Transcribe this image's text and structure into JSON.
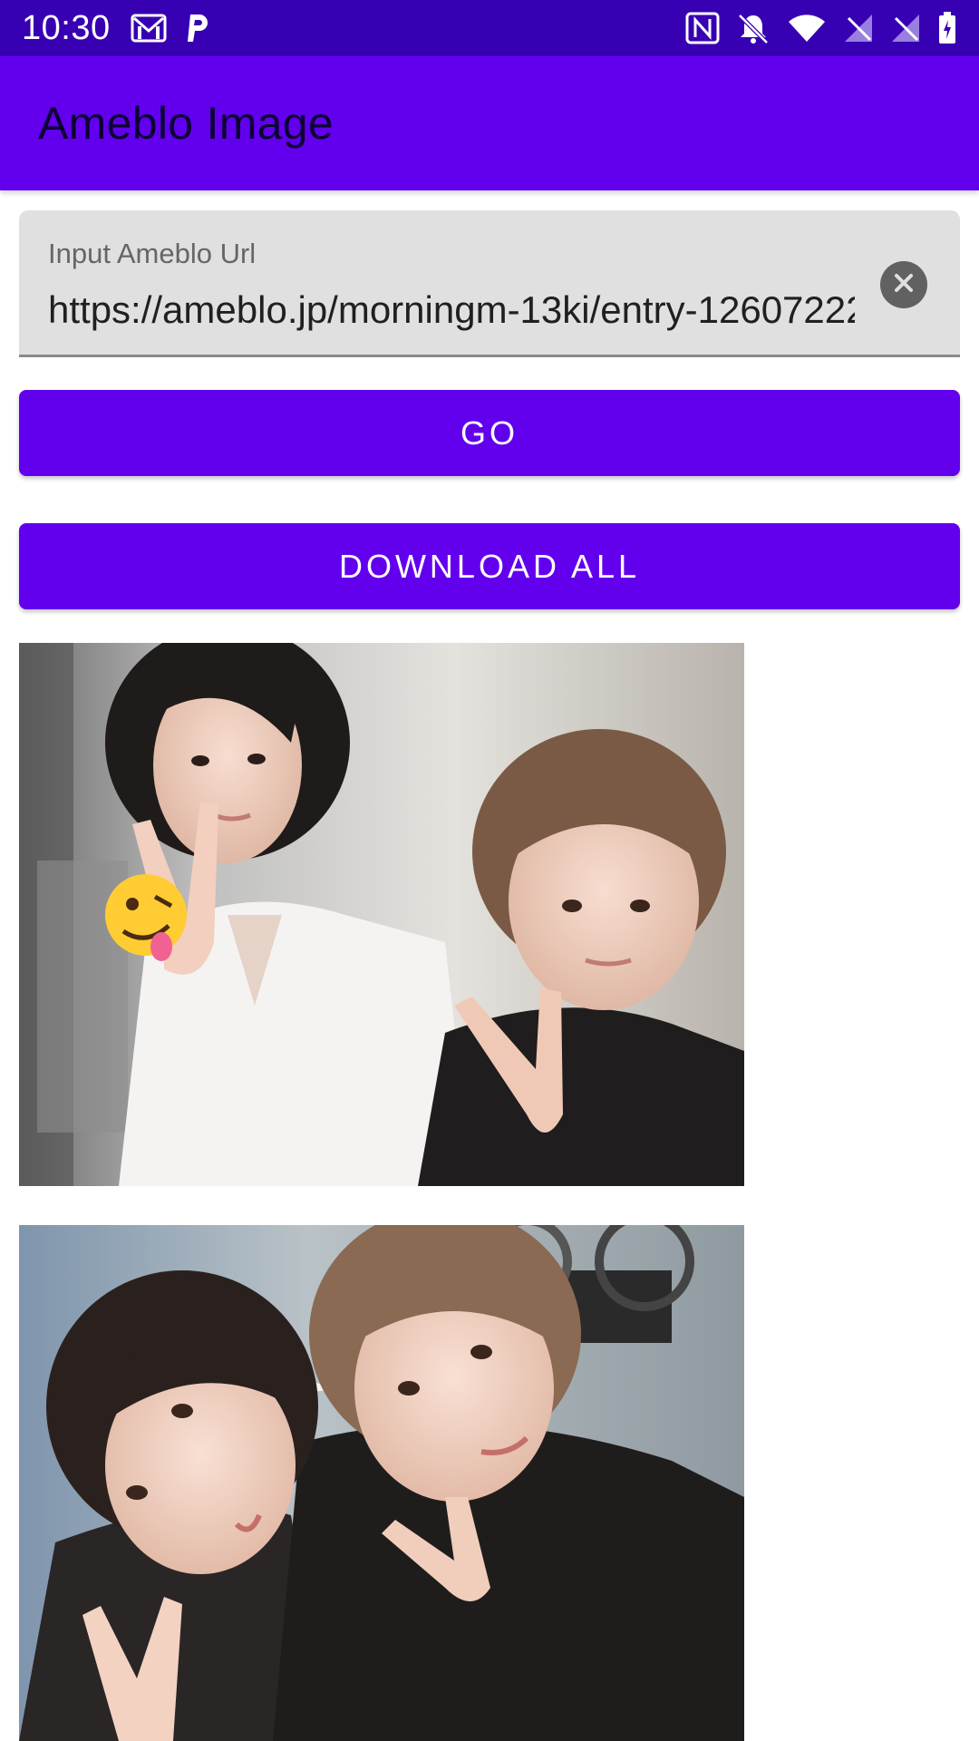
{
  "status_bar": {
    "time": "10:30",
    "left_icons": [
      "gmail-icon",
      "parking-icon"
    ],
    "right_icons": [
      "nfc-icon",
      "bell-off-icon",
      "wifi-icon",
      "signal-icon",
      "signal-icon",
      "battery-icon"
    ]
  },
  "app_bar": {
    "title": "Ameblo Image"
  },
  "url_field": {
    "label": "Input Ameblo Url",
    "value": "https://ameblo.jp/morningm-13ki/entry-12607222"
  },
  "buttons": {
    "go_label": "GO",
    "download_all_label": "DOWNLOAD ALL"
  },
  "images": [
    {
      "kind": "photo",
      "description_icon": "photo-image"
    },
    {
      "kind": "photo",
      "description_icon": "photo-image"
    }
  ],
  "colors": {
    "status_bar": "#3700b3",
    "primary": "#6200ee",
    "field_background": "#e0e0e0"
  }
}
